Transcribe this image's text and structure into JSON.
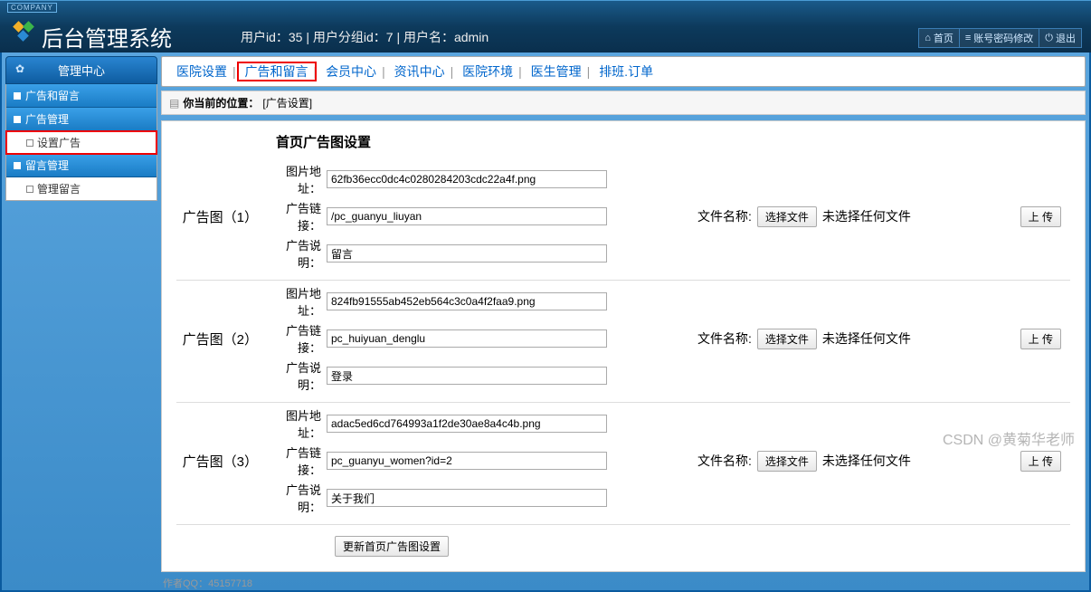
{
  "header": {
    "company_tag": "COMPANY",
    "title": "后台管理系统",
    "user_line": "用户id：35 | 用户分组id：7 | 用户名：admin",
    "actions": {
      "home": "首页",
      "account": "账号密码修改",
      "logout": "退出"
    }
  },
  "sidebar": {
    "head": "管理中心",
    "cat_current": "广告和留言",
    "groups": [
      {
        "title": "广告管理",
        "items": [
          {
            "label": "设置广告",
            "highlight": true
          }
        ]
      },
      {
        "title": "留言管理",
        "items": [
          {
            "label": "管理留言",
            "highlight": false
          }
        ]
      }
    ]
  },
  "topnav": {
    "items": [
      "医院设置",
      "广告和留言",
      "会员中心",
      "资讯中心",
      "医院环境",
      "医生管理",
      "排班.订单"
    ],
    "active_index": 1
  },
  "breadcrumb": {
    "prefix": "你当前的位置：",
    "loc": "[广告设置]"
  },
  "content": {
    "section_title": "首页广告图设置",
    "field_labels": {
      "img": "图片地址：",
      "link": "广告链接：",
      "desc": "广告说明："
    },
    "file_label": "文件名称:",
    "choose_btn": "选择文件",
    "no_file": "未选择任何文件",
    "upload_btn": "上 传",
    "rows": [
      {
        "name": "广告图（1）",
        "img": "62fb36ecc0dc4c0280284203cdc22a4f.png",
        "link": "/pc_guanyu_liuyan",
        "desc": "留言"
      },
      {
        "name": "广告图（2）",
        "img": "824fb91555ab452eb564c3c0a4f2faa9.png",
        "link": "pc_huiyuan_denglu",
        "desc": "登录"
      },
      {
        "name": "广告图（3）",
        "img": "adac5ed6cd764993a1f2de30ae8a4c4b.png",
        "link": "pc_guanyu_women?id=2",
        "desc": "关于我们"
      }
    ],
    "submit": "更新首页广告图设置"
  },
  "footer": {
    "author": "作者QQ：45157718"
  },
  "watermark": "CSDN @黄菊华老师"
}
